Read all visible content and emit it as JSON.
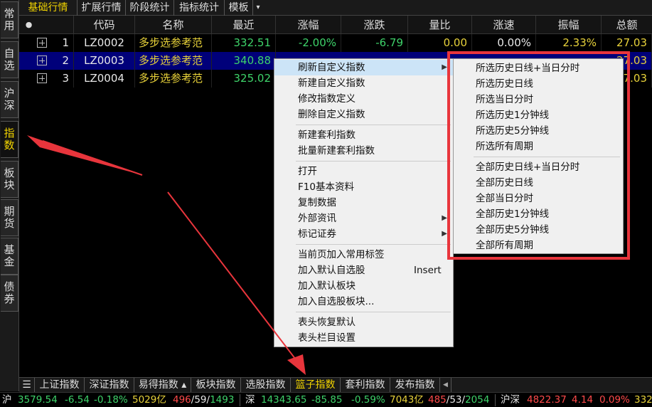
{
  "left_tabs": [
    "常用",
    "自选",
    "沪深",
    "指数",
    "板块",
    "期货",
    "基金",
    "债券"
  ],
  "left_active": 3,
  "top_tabs": [
    "基础行情",
    "扩展行情",
    "阶段统计",
    "指标统计",
    "模板"
  ],
  "top_more": "▾",
  "header": {
    "dot": "●",
    "cols": [
      "代码",
      "名称",
      "最近",
      "涨幅",
      "涨跌",
      "量比",
      "涨速",
      "振幅",
      "总额"
    ]
  },
  "rows": [
    {
      "idx": "1",
      "code": "LZ0002",
      "name": "多步选参考范",
      "last": "332.51",
      "chg_pct": "-2.00%",
      "chg": "-6.79",
      "vol_ratio": "0.00",
      "speed": "0.00%",
      "amp": "2.33%",
      "amount": "27.03"
    },
    {
      "idx": "2",
      "code": "LZ0003",
      "name": "多步选参考范",
      "last": "340.88",
      "chg_pct": "",
      "chg": "",
      "vol_ratio": "",
      "speed": "",
      "amp": "",
      "amount": "27.03"
    },
    {
      "idx": "3",
      "code": "LZ0004",
      "name": "多步选参考范",
      "last": "325.02",
      "chg_pct": "",
      "chg": "",
      "vol_ratio": "",
      "speed": "",
      "amp": "",
      "amount": "27.03"
    }
  ],
  "context_menu": {
    "items": [
      {
        "label": "刷新自定义指数",
        "arrow": "▶"
      },
      {
        "label": "新建自定义指数"
      },
      {
        "label": "修改指数定义"
      },
      {
        "label": "删除自定义指数"
      },
      {
        "label": "新建套利指数"
      },
      {
        "label": "批量新建套利指数"
      },
      {
        "label": "打开"
      },
      {
        "label": "F10基本资料"
      },
      {
        "label": "复制数据"
      },
      {
        "label": "外部资讯",
        "arrow": "▶"
      },
      {
        "label": "标记证券",
        "arrow": "▶"
      },
      {
        "label": "当前页加入常用标签"
      },
      {
        "label": "加入默认自选股",
        "shortcut": "Insert"
      },
      {
        "label": "加入默认板块"
      },
      {
        "label": "加入自选股板块..."
      },
      {
        "label": "表头恢复默认"
      },
      {
        "label": "表头栏目设置"
      }
    ]
  },
  "submenu": {
    "items": [
      "所选历史日线+当日分时",
      "所选历史日线",
      "所选当日分时",
      "所选历史1分钟线",
      "所选历史5分钟线",
      "所选所有周期",
      "全部历史日线+当日分时",
      "全部历史日线",
      "全部当日分时",
      "全部历史1分钟线",
      "全部历史5分钟线",
      "全部所有周期"
    ]
  },
  "bottom_menu_icon": "☰",
  "bottom_tabs": [
    "上证指数",
    "深证指数",
    "易得指数 ▴",
    "板块指数",
    "选股指数",
    "篮子指数",
    "套利指数",
    "发布指数"
  ],
  "bottom_active": 5,
  "bottom_scroll": "◀",
  "status": {
    "sh_label": "沪",
    "sh_index": "3579.54",
    "sh_chg": "-6.54",
    "sh_pct": "-0.18%",
    "sh_amount": "5029亿",
    "sh_up": "496",
    "sh_flat": "59",
    "sh_down": "1493",
    "sz_label": "深",
    "sz_index": "14343.65",
    "sz_chg": "-85.85",
    "sz_pct": "-0.59%",
    "sz_amount": "7043亿",
    "sz_up": "485",
    "sz_flat": "53",
    "sz_down": "2054",
    "hs_label": "沪深",
    "hs_index": "4822.37",
    "hs_chg": "4.14",
    "hs_pct": "0.09%",
    "hs_amount": "332"
  },
  "colors": {
    "accent_yellow": "#f2d400",
    "up_red": "#ff4a4a",
    "down_green": "#3ed36a",
    "annotation_red": "#e8353c",
    "selected_row": "#00007a"
  }
}
